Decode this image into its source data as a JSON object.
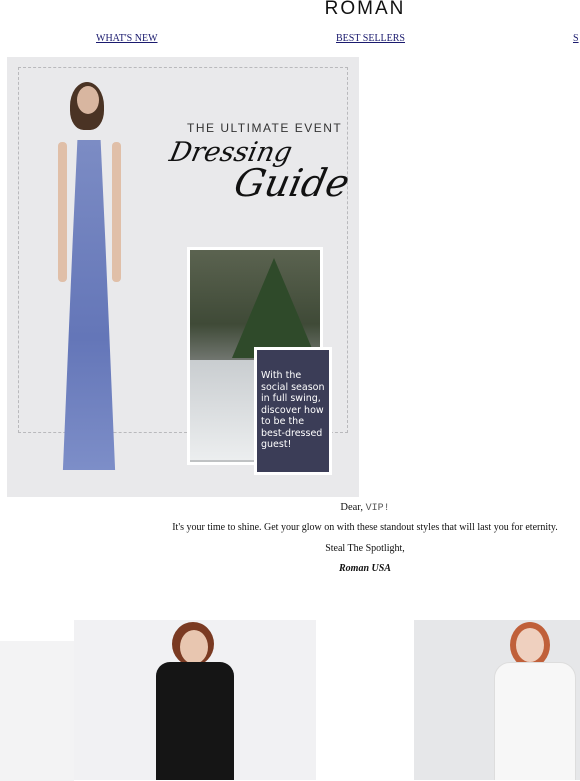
{
  "header": {
    "logo": "ROMAN"
  },
  "nav": {
    "items": [
      {
        "label": "WHAT'S NEW"
      },
      {
        "label": "BEST SELLERS"
      },
      {
        "label": "S"
      }
    ]
  },
  "hero": {
    "eyebrow": "THE ULTIMATE EVENT",
    "script_word_1": "Dressing",
    "script_word_2": "Guide",
    "callout": "With the social season in full swing, discover how to be the best-dressed guest!"
  },
  "message": {
    "greeting": "Dear,",
    "name_token": "VIP!",
    "body": "It's your time to shine. Get your glow on with these standout styles that will last you for eternity.",
    "closing": "Steal The Spotlight,",
    "signature": "Roman USA"
  },
  "colors": {
    "hero_bg": "#e9e9eb",
    "callout_bg": "#3b3d57",
    "nav_link": "#1a1a6e",
    "dress": "#6f80bf"
  }
}
